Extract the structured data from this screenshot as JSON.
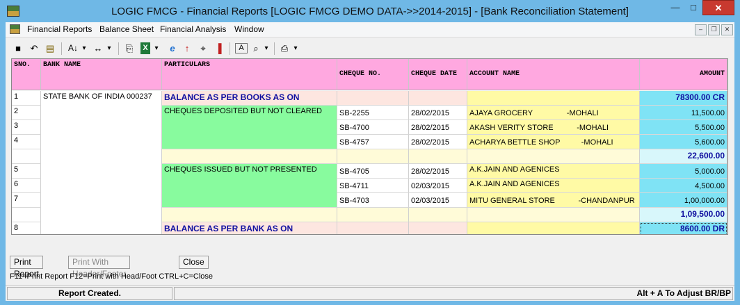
{
  "window": {
    "title": "LOGIC FMCG - Financial Reports  [LOGIC FMCG DEMO DATA->>2014-2015] - [Bank Reconciliation Statement]",
    "min_glyph": "—",
    "max_glyph": "□",
    "close_glyph": "✕"
  },
  "menu": {
    "items": [
      "Financial Reports",
      "Balance Sheet",
      "Financial Analysis",
      "Window"
    ],
    "mdi_min": "–",
    "mdi_restore": "❐",
    "mdi_close": "✕"
  },
  "toolbar": {
    "icons": [
      "save-icon",
      "undo-icon",
      "open-report-icon",
      "sort-icon",
      "dropdown-icon",
      "column-width-icon",
      "dropdown-icon",
      "copy-icon",
      "excel-icon",
      "dropdown-icon",
      "browser-icon",
      "up-arrow-icon",
      "find-icon",
      "chart-icon",
      "font-icon",
      "print-preview-icon",
      "dropdown-icon",
      "print-icon",
      "dropdown-icon"
    ],
    "glyphs": [
      "■",
      "↶",
      "▤",
      "A↓",
      "▾",
      "↔",
      "▾",
      "⎘",
      "X",
      "▾",
      "e",
      "↑",
      "⌖",
      "▐",
      "A",
      "⌕",
      "▾",
      "⎙",
      "▾"
    ]
  },
  "table": {
    "headers": {
      "sno": "SNO.",
      "bank": "BANK NAME",
      "particulars": "PARTICULARS",
      "cheque_no": "CHEQUE NO.",
      "cheque_date": "CHEQUE DATE",
      "account": "ACCOUNT NAME",
      "amount": "AMOUNT"
    },
    "bank_name": "STATE BANK OF INDIA 000237",
    "balance_books_label": "BALANCE AS PER BOOKS AS ON",
    "balance_books_amount": "78300.00 CR",
    "group1_label": "CHEQUES DEPOSITED BUT NOT CLEARED",
    "group2_label": "CHEQUES ISSUED BUT NOT PRESENTED",
    "rows": [
      {
        "sno": "2",
        "cheque": "SB-2255",
        "date": "28/02/2015",
        "account": "AJAYA GROCERY                -MOHALI",
        "amount": "11,500.00"
      },
      {
        "sno": "3",
        "cheque": "SB-4700",
        "date": "28/02/2015",
        "account": "AKASH VERITY STORE           -MOHALI",
        "amount": "5,500.00"
      },
      {
        "sno": "4",
        "cheque": "SB-4757",
        "date": "28/02/2015",
        "account": "ACHARYA BETTLE SHOP          -MOHALI",
        "amount": "5,600.00"
      },
      {
        "sno": "5",
        "cheque": "SB-4705",
        "date": "28/02/2015",
        "account": "A.K.JAIN AND AGENICES",
        "amount": "5,000.00"
      },
      {
        "sno": "6",
        "cheque": "SB-4711",
        "date": "02/03/2015",
        "account": "A.K.JAIN AND AGENICES",
        "amount": "4,500.00"
      },
      {
        "sno": "7",
        "cheque": "SB-4703",
        "date": "02/03/2015",
        "account": "MITU GENERAL STORE           -CHANDANPUR",
        "amount": "1,00,000.00"
      }
    ],
    "sno_1": "1",
    "sno_8": "8",
    "subtotal1": "22,600.00",
    "subtotal2": "1,09,500.00",
    "balance_bank_label": "BALANCE AS PER BANK AS ON",
    "balance_bank_amount": "8600.00 DR"
  },
  "buttons": {
    "print_report": "Print Report",
    "print_header": "Print With Header/Footer",
    "close": "Close"
  },
  "hint": "F11=Print Report  F12=Print with Head/Foot  CTRL+C=Close",
  "status": {
    "left": "Report Created.",
    "right": "Alt + A To Adjust BR/BP"
  },
  "colors": {
    "header": "#ffa8e0",
    "particulars_group": "#88fb9e",
    "account": "#fffaa5",
    "amount": "#7fe3f5",
    "balance_row": "#fde6e0",
    "title_bar": "#6fb8e6"
  }
}
